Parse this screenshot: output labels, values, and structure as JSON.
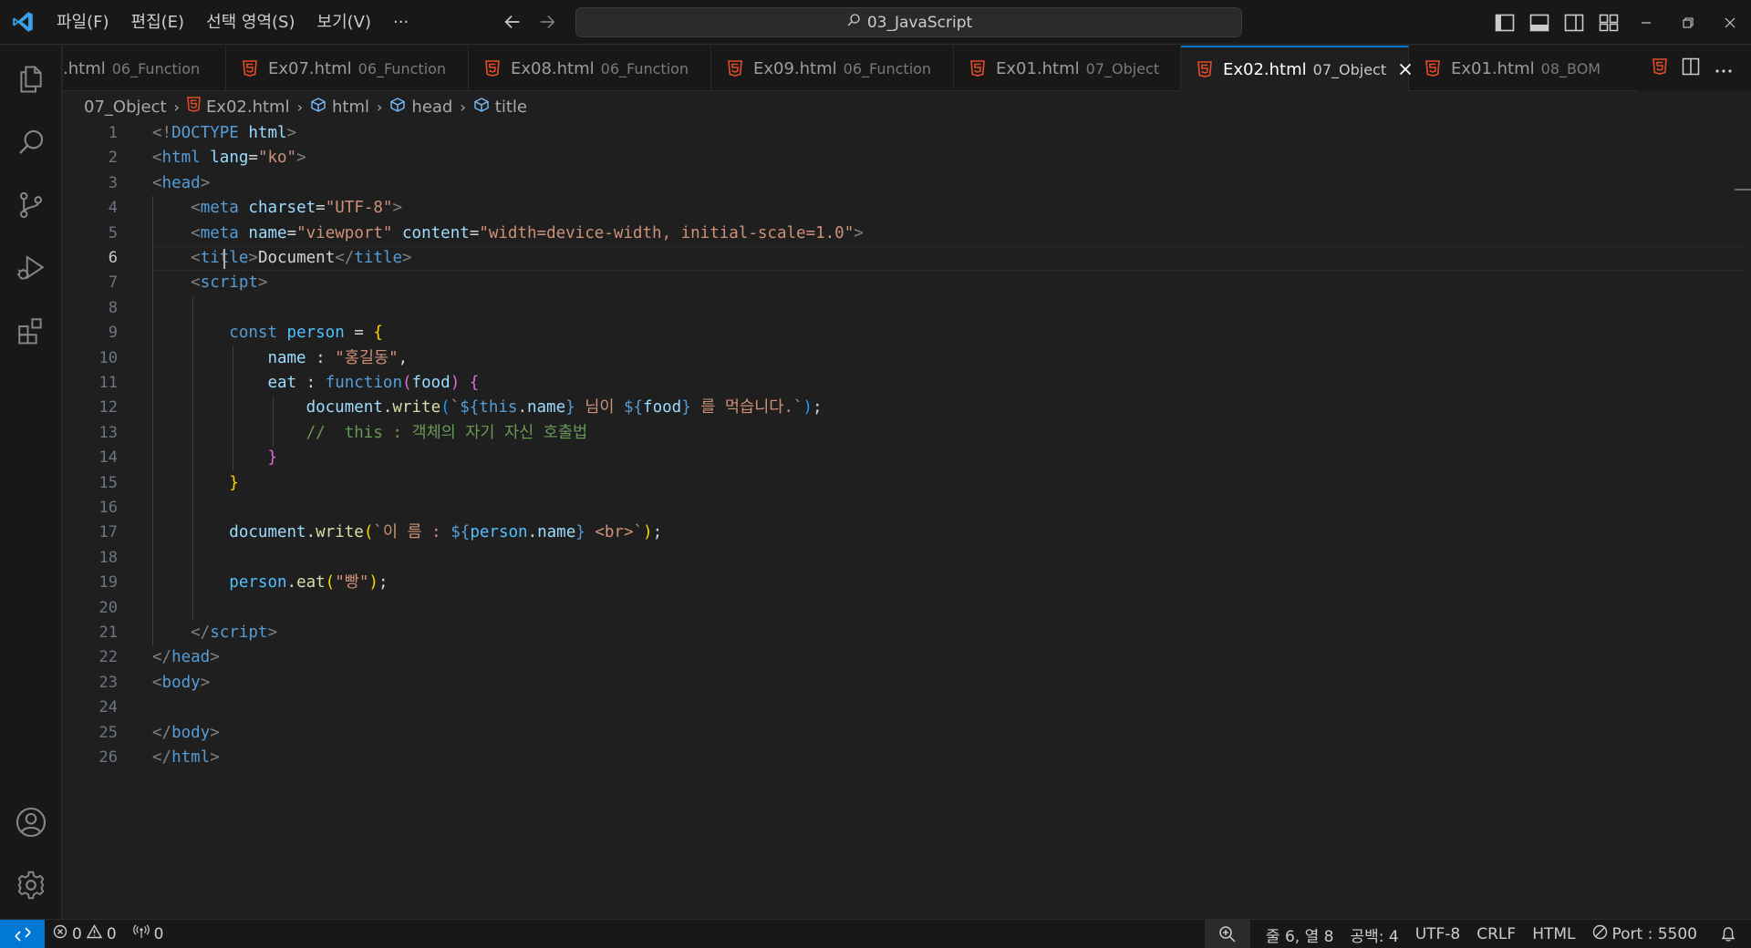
{
  "titlebar": {
    "menu": [
      "파일(F)",
      "편집(E)",
      "선택 영역(S)",
      "보기(V)",
      "···"
    ],
    "search_text": "03_JavaScript"
  },
  "tabs": [
    {
      "name": ".html",
      "desc": "06_Function",
      "partial": true
    },
    {
      "name": "Ex07.html",
      "desc": "06_Function"
    },
    {
      "name": "Ex08.html",
      "desc": "06_Function"
    },
    {
      "name": "Ex09.html",
      "desc": "06_Function"
    },
    {
      "name": "Ex01.html",
      "desc": "07_Object"
    },
    {
      "name": "Ex02.html",
      "desc": "07_Object",
      "active": true
    },
    {
      "name": "Ex01.html",
      "desc": "08_BOM"
    }
  ],
  "breadcrumb": {
    "folder": "07_Object",
    "file": "Ex02.html",
    "node1": "html",
    "node2": "head",
    "node3": "title"
  },
  "editor": {
    "line_numbers": [
      "1",
      "2",
      "3",
      "4",
      "5",
      "6",
      "7",
      "8",
      "9",
      "10",
      "11",
      "12",
      "13",
      "14",
      "15",
      "16",
      "17",
      "18",
      "19",
      "20",
      "21",
      "22",
      "23",
      "24",
      "25",
      "26"
    ],
    "current_line": 6
  },
  "statusbar": {
    "errors": "0",
    "warnings": "0",
    "ports": "0",
    "position": "줄 6, 열 8",
    "spaces": "공백: 4",
    "encoding": "UTF-8",
    "eol": "CRLF",
    "language": "HTML",
    "port": "Port : 5500"
  },
  "colors": {
    "accent": "#0078d4",
    "html_icon": "#e44d26",
    "background": "#1f1f1f"
  }
}
